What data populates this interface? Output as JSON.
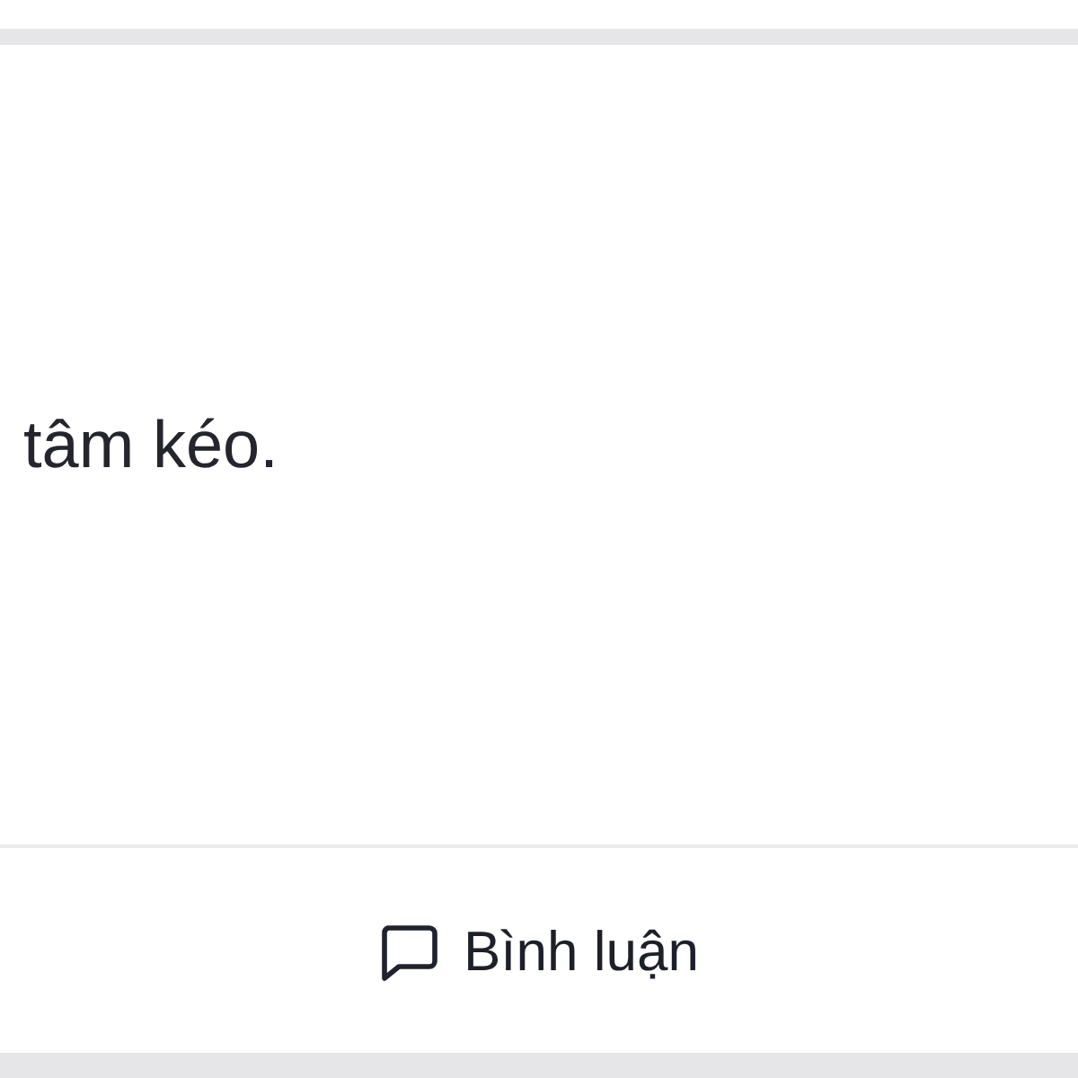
{
  "post": {
    "text": "tâm kéo."
  },
  "actions": [
    {
      "kind": "comment",
      "label": "Bình luận"
    }
  ]
}
